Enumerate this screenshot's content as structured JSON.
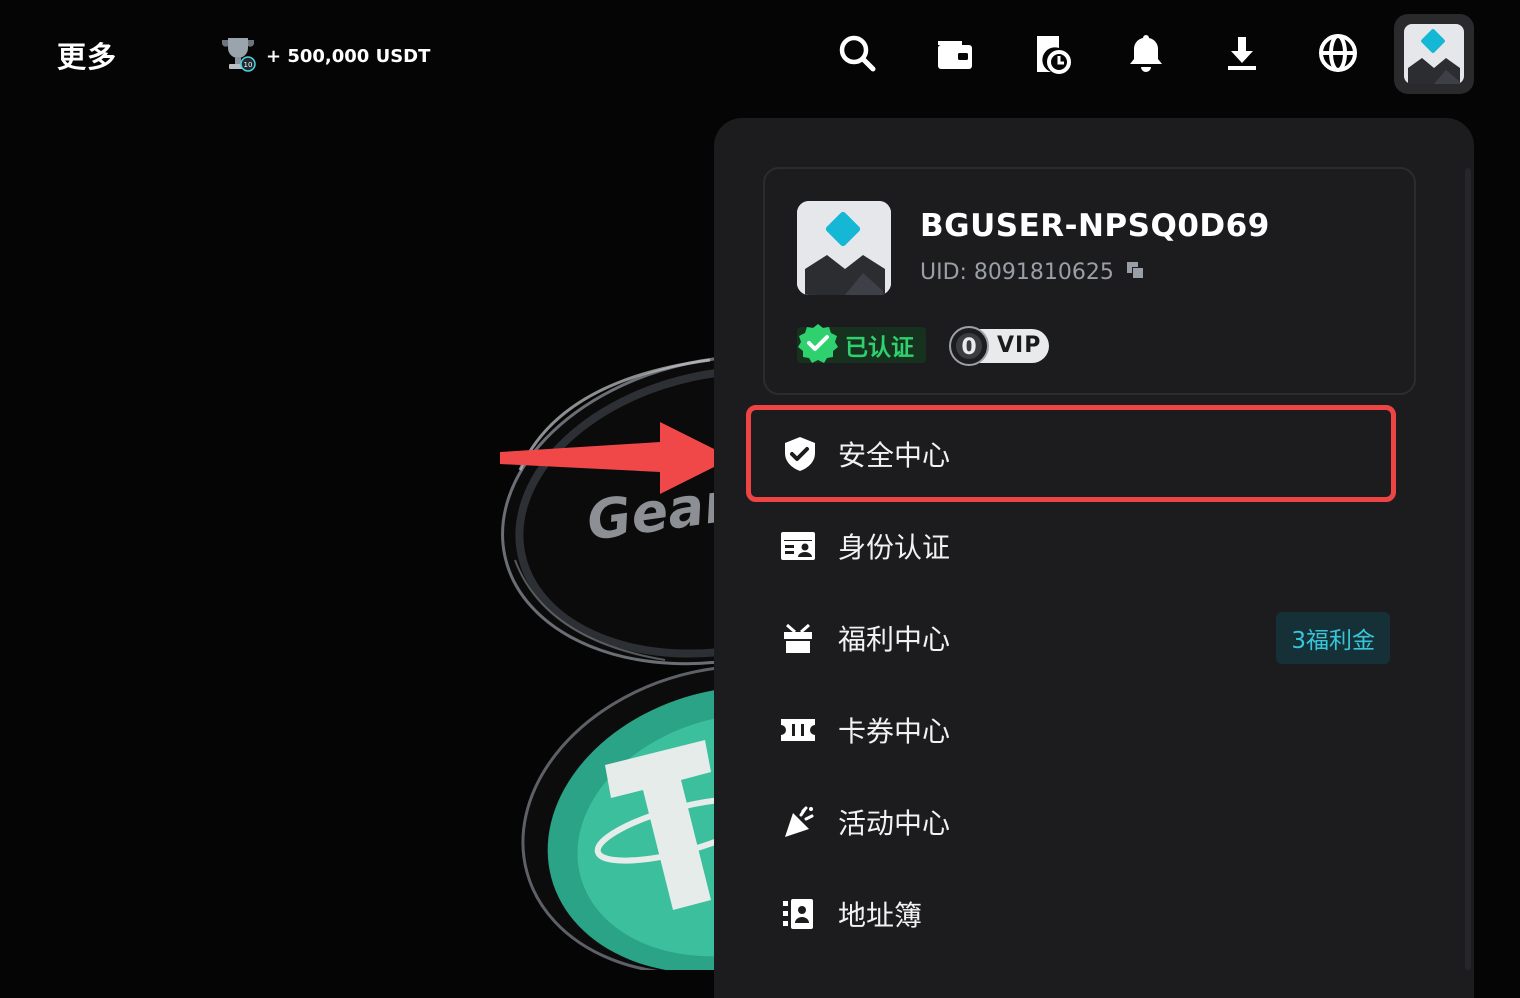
{
  "topbar": {
    "more_label": "更多",
    "promo_text": "+ 500,000 USDT",
    "icons": [
      "search-icon",
      "wallet-icon",
      "orders-history-icon",
      "bell-icon",
      "download-icon",
      "globe-icon",
      "avatar"
    ]
  },
  "background": {
    "coin_text": "Gear"
  },
  "profile": {
    "username": "BGUSER-NPSQ0D69",
    "uid": "UID: 8091810625",
    "verified_label": "已认证",
    "vip_level": "0",
    "vip_label": "VIP"
  },
  "menu": {
    "items": [
      {
        "label": "安全中心",
        "icon": "shield-check-icon",
        "highlighted": true
      },
      {
        "label": "身份认证",
        "icon": "id-card-icon"
      },
      {
        "label": "福利中心",
        "icon": "gift-icon",
        "badge": "3福利金"
      },
      {
        "label": "卡券中心",
        "icon": "ticket-icon"
      },
      {
        "label": "活动中心",
        "icon": "party-popper-icon"
      },
      {
        "label": "地址簿",
        "icon": "address-book-icon"
      }
    ]
  },
  "colors": {
    "highlight_border": "#ef4444",
    "verified_green": "#2fd16e",
    "badge_cyan": "#37c6d8",
    "panel_bg": "#1c1c1e",
    "avatar_diamond": "#14b8d4"
  }
}
